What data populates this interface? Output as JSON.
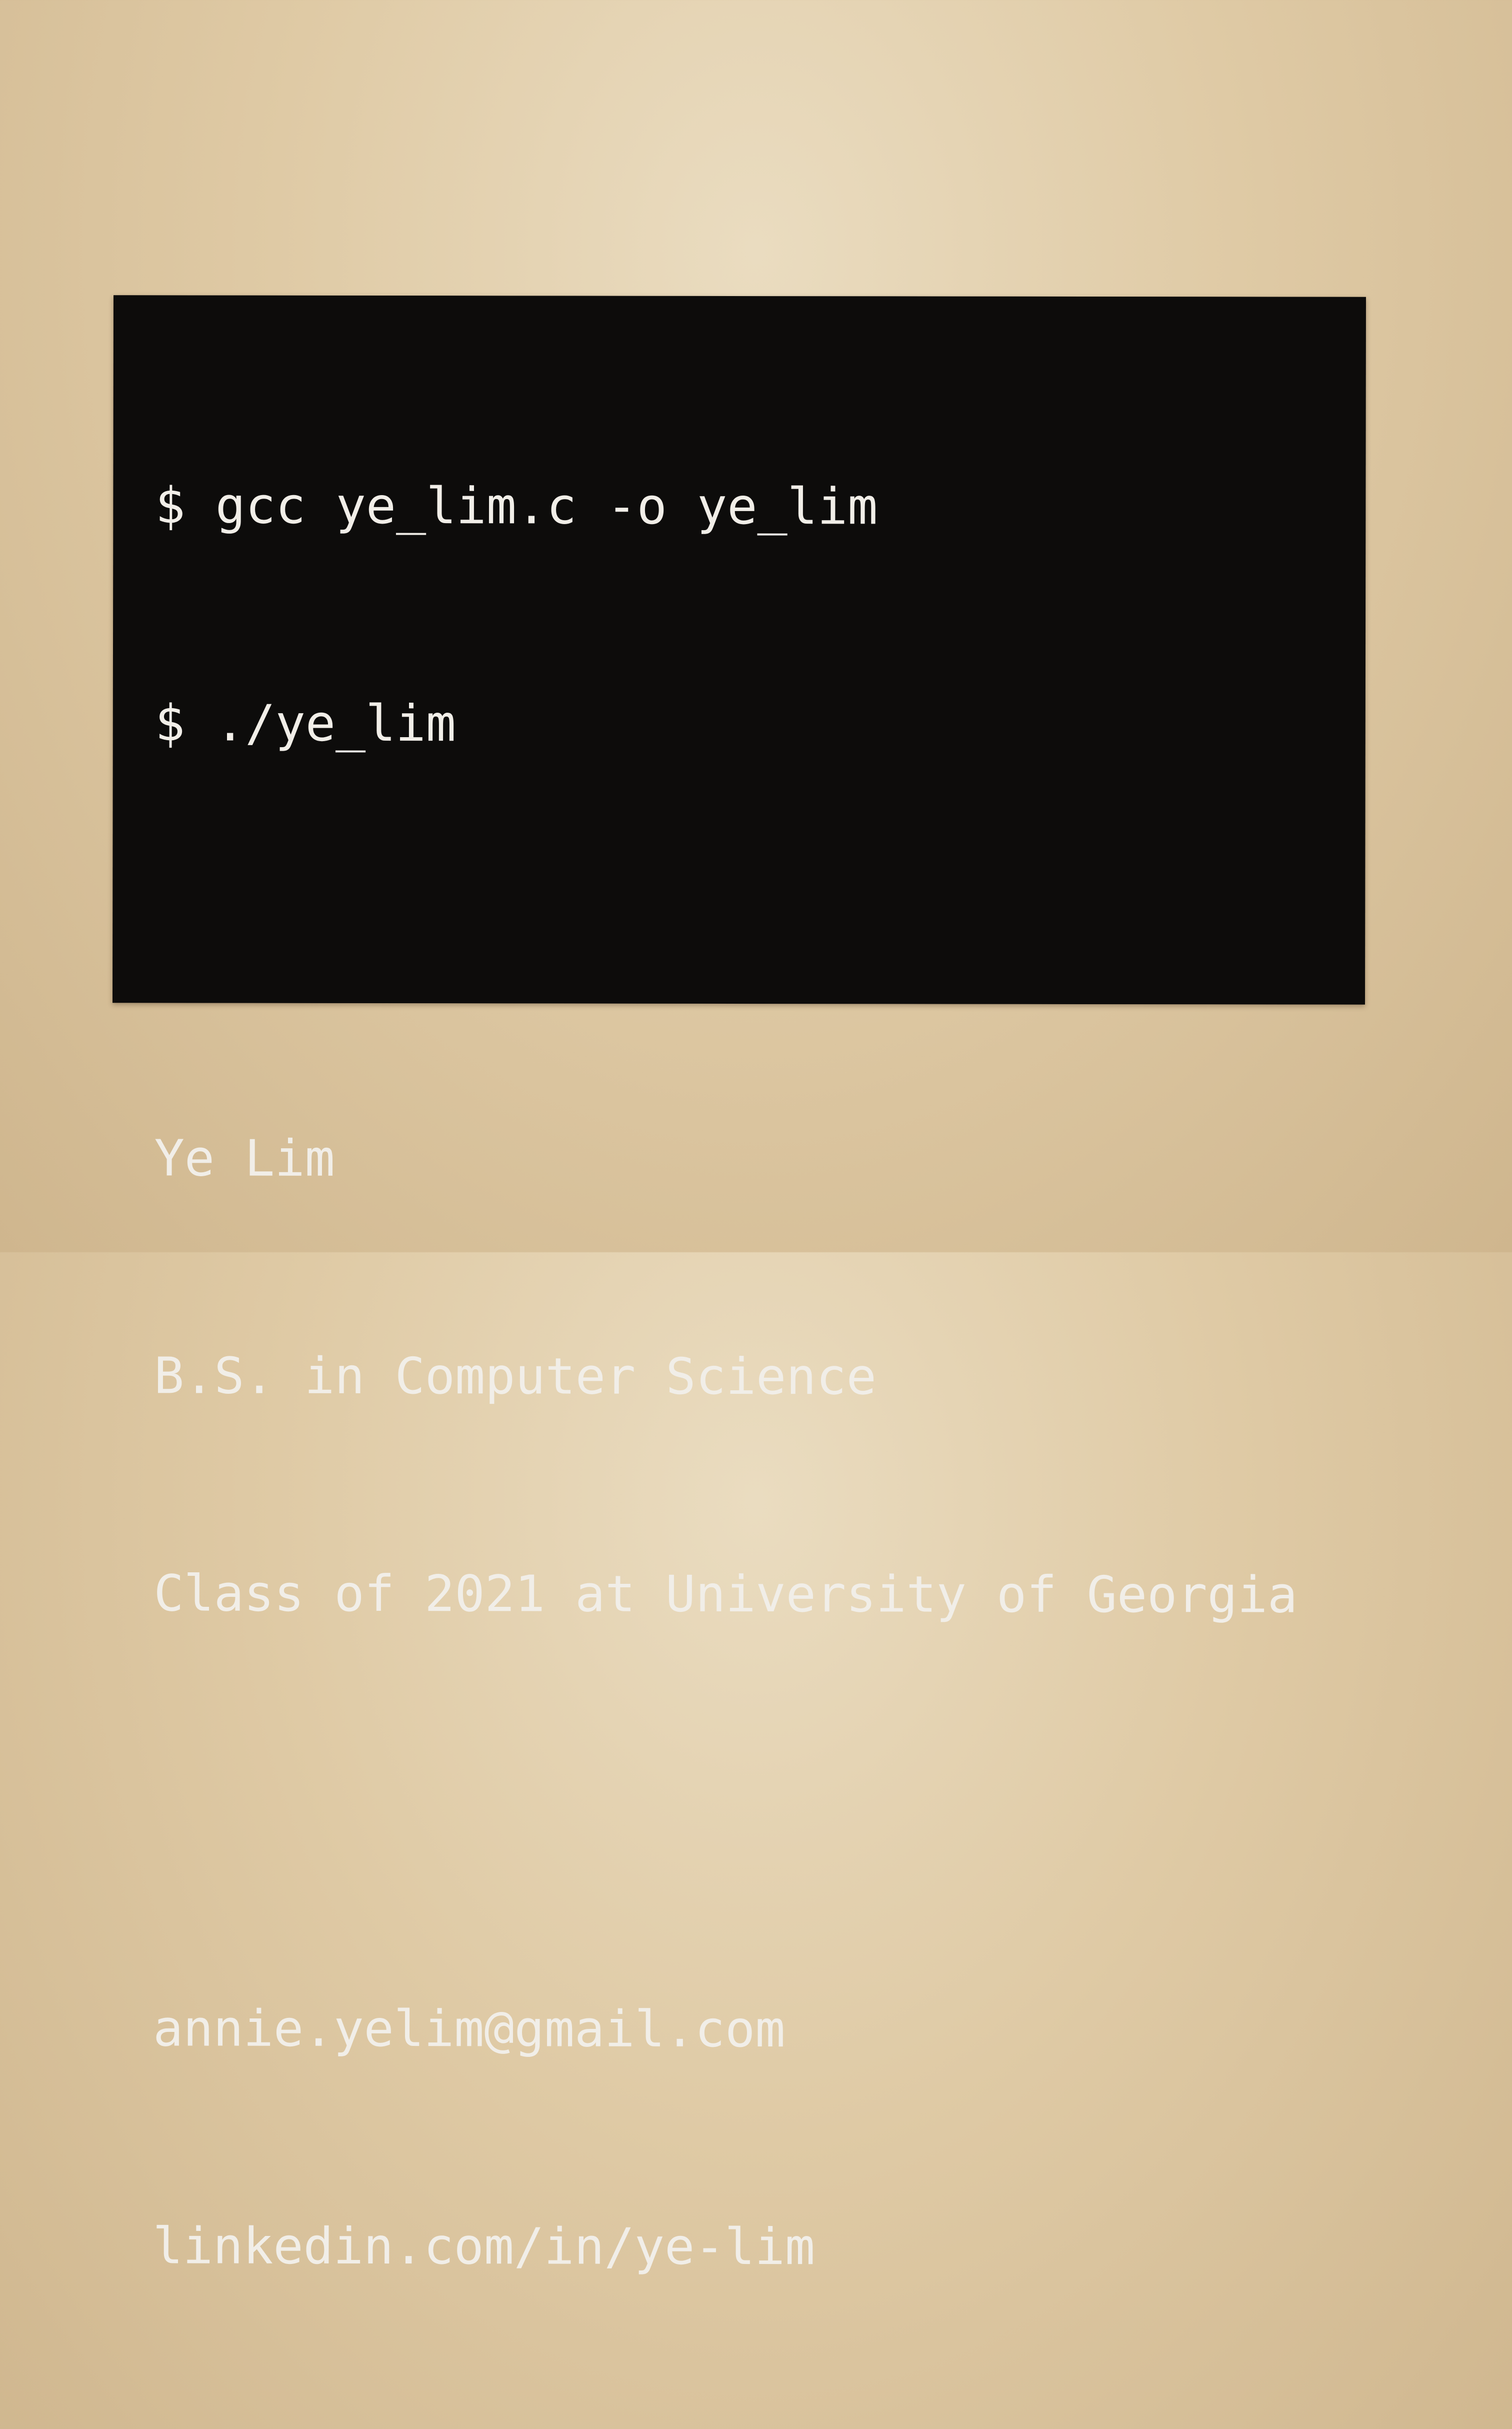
{
  "card": {
    "lines": [
      "$ gcc ye_lim.c -o ye_lim",
      "$ ./ye_lim",
      "",
      "Ye Lim",
      "B.S. in Computer Science",
      "Class of 2021 at University of Georgia",
      "",
      "annie.yelim@gmail.com",
      "linkedin.com/in/ye-lim"
    ],
    "background_color": "#0d0c0b",
    "text_color": "#f1eee8"
  }
}
